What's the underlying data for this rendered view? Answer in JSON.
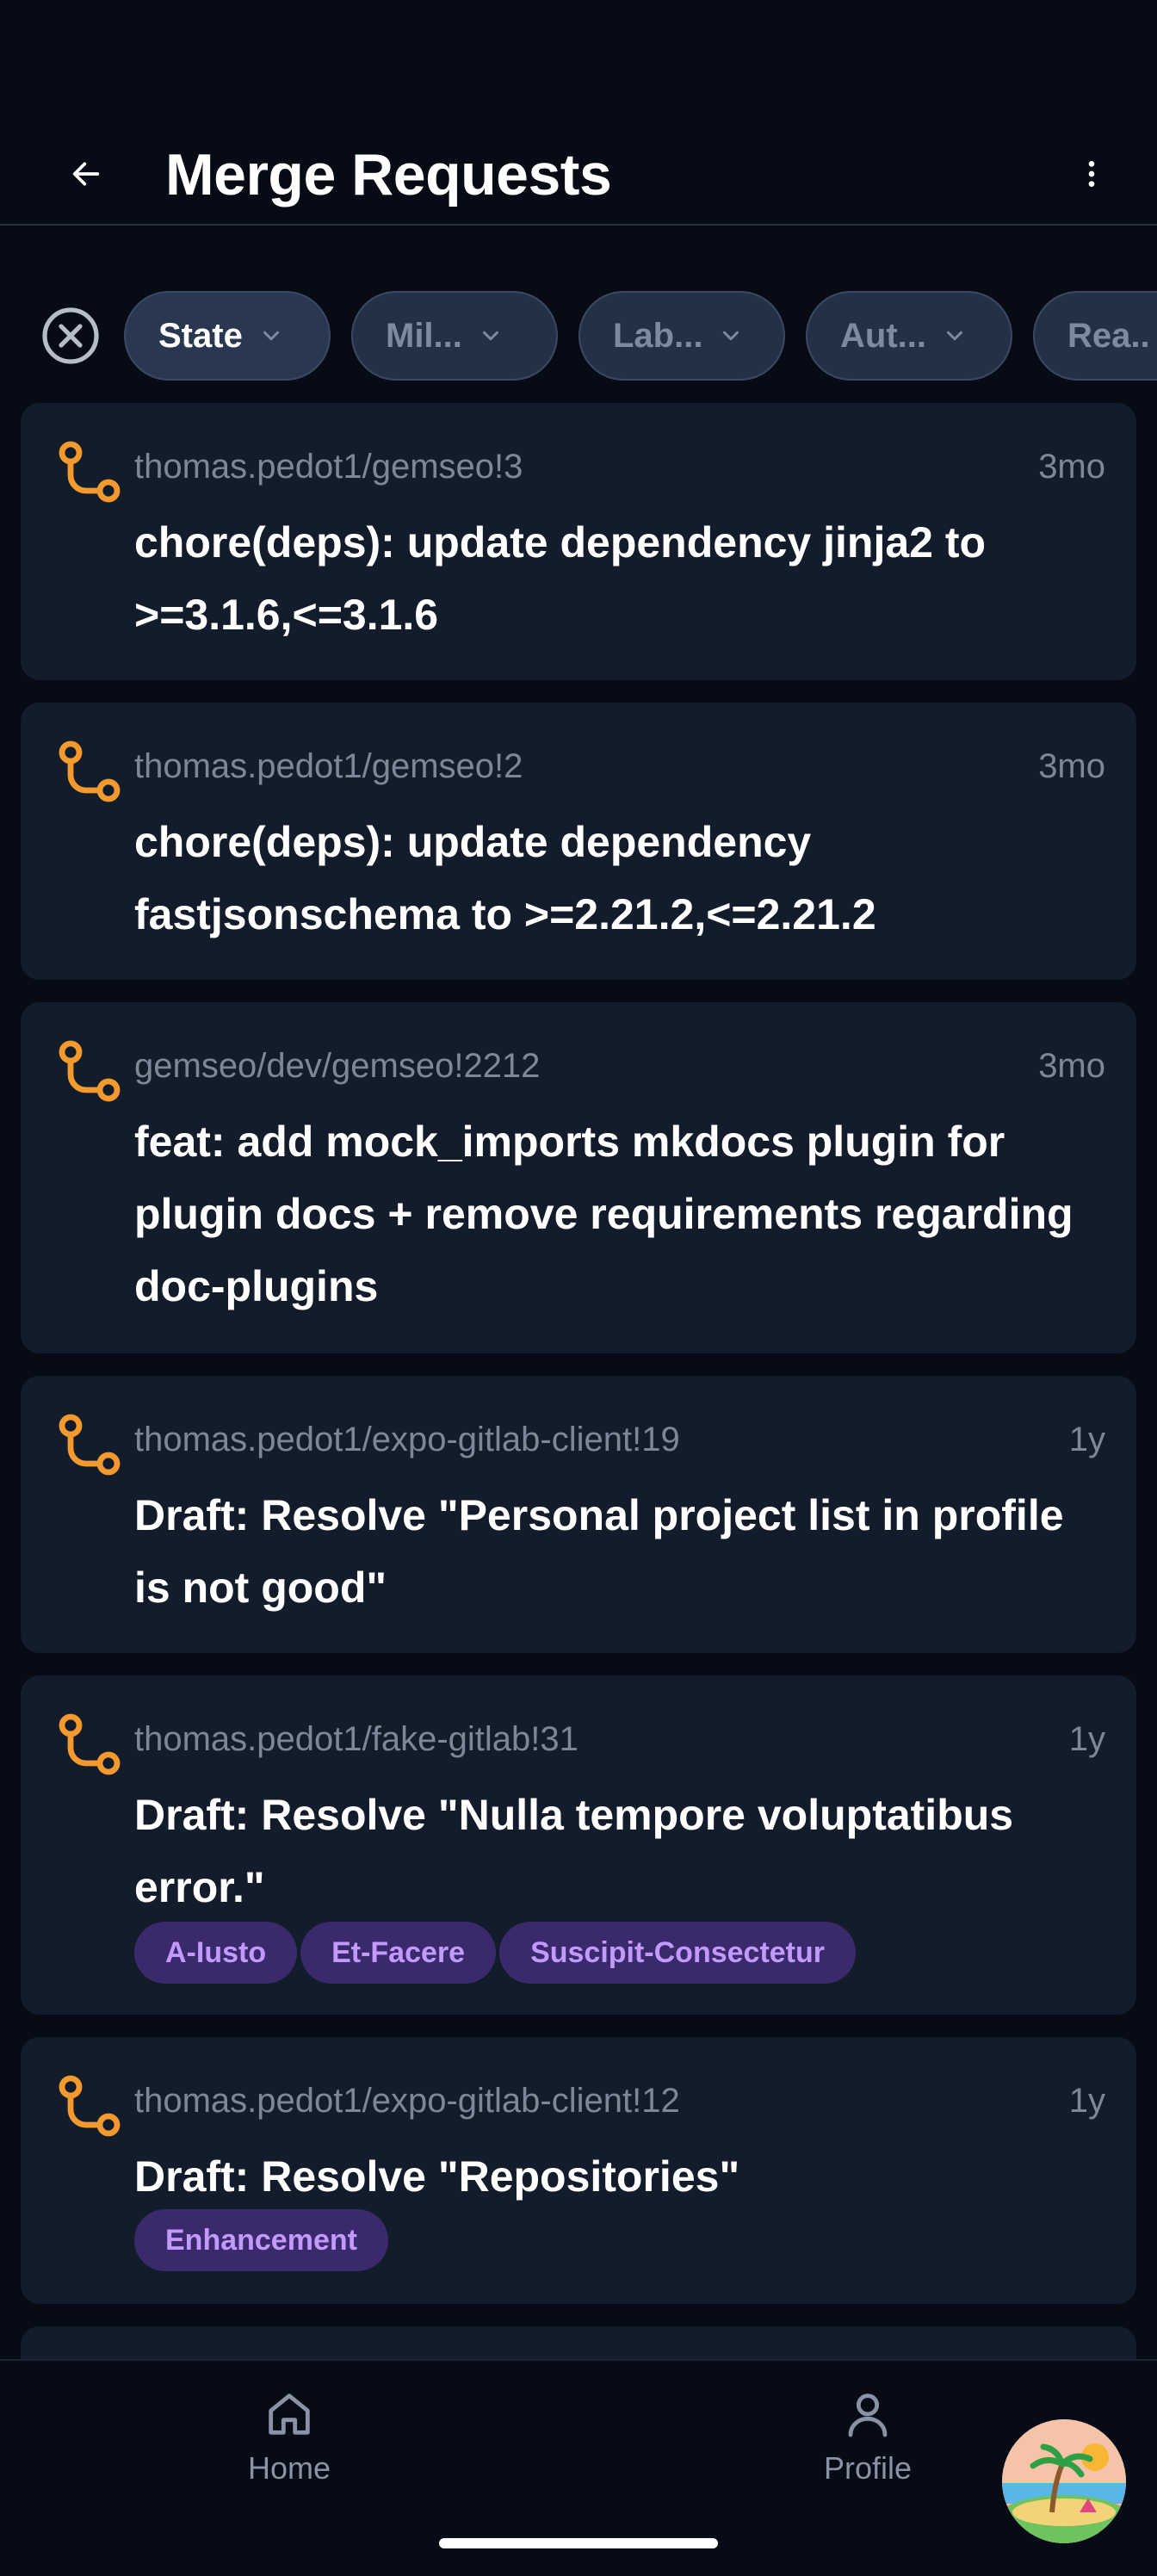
{
  "header": {
    "title": "Merge Requests"
  },
  "filters": [
    {
      "label": "State",
      "active": true
    },
    {
      "label": "Mil...",
      "active": false
    },
    {
      "label": "Lab...",
      "active": false
    },
    {
      "label": "Aut...",
      "active": false
    },
    {
      "label": "Rea..",
      "active": false
    }
  ],
  "merge_requests": [
    {
      "ref": "thomas.pedot1/gemseo!3",
      "age": "3mo",
      "title": "chore(deps): update dependency jinja2 to >=3.1.6,<=3.1.6",
      "labels": []
    },
    {
      "ref": "thomas.pedot1/gemseo!2",
      "age": "3mo",
      "title": "chore(deps): update dependency fastjsonschema to >=2.21.2,<=2.21.2",
      "labels": []
    },
    {
      "ref": "gemseo/dev/gemseo!2212",
      "age": "3mo",
      "title": "feat: add mock_imports mkdocs plugin for plugin docs + remove requirements regarding doc-plugins",
      "labels": []
    },
    {
      "ref": "thomas.pedot1/expo-gitlab-client!19",
      "age": "1y",
      "title": "Draft: Resolve \"Personal project list in profile is not good\"",
      "labels": []
    },
    {
      "ref": "thomas.pedot1/fake-gitlab!31",
      "age": "1y",
      "title": "Draft: Resolve \"Nulla tempore voluptatibus error.\"",
      "labels": [
        "A-Iusto",
        "Et-Facere",
        "Suscipit-Consectetur"
      ]
    },
    {
      "ref": "thomas.pedot1/expo-gitlab-client!12",
      "age": "1y",
      "title": "Draft: Resolve \"Repositories\"",
      "labels": [
        "Enhancement"
      ]
    }
  ],
  "nav": {
    "home": "Home",
    "profile": "Profile"
  },
  "colors": {
    "accent": "#f29a2e",
    "label_bg": "#3a2a6b",
    "label_text": "#c29aff",
    "card_bg": "#131c2b"
  },
  "icons": {
    "back": "arrow-left-icon",
    "more": "more-vertical-icon",
    "clear": "close-circle-icon",
    "merge_request": "merge-request-icon",
    "home": "home-icon",
    "profile": "user-icon"
  }
}
